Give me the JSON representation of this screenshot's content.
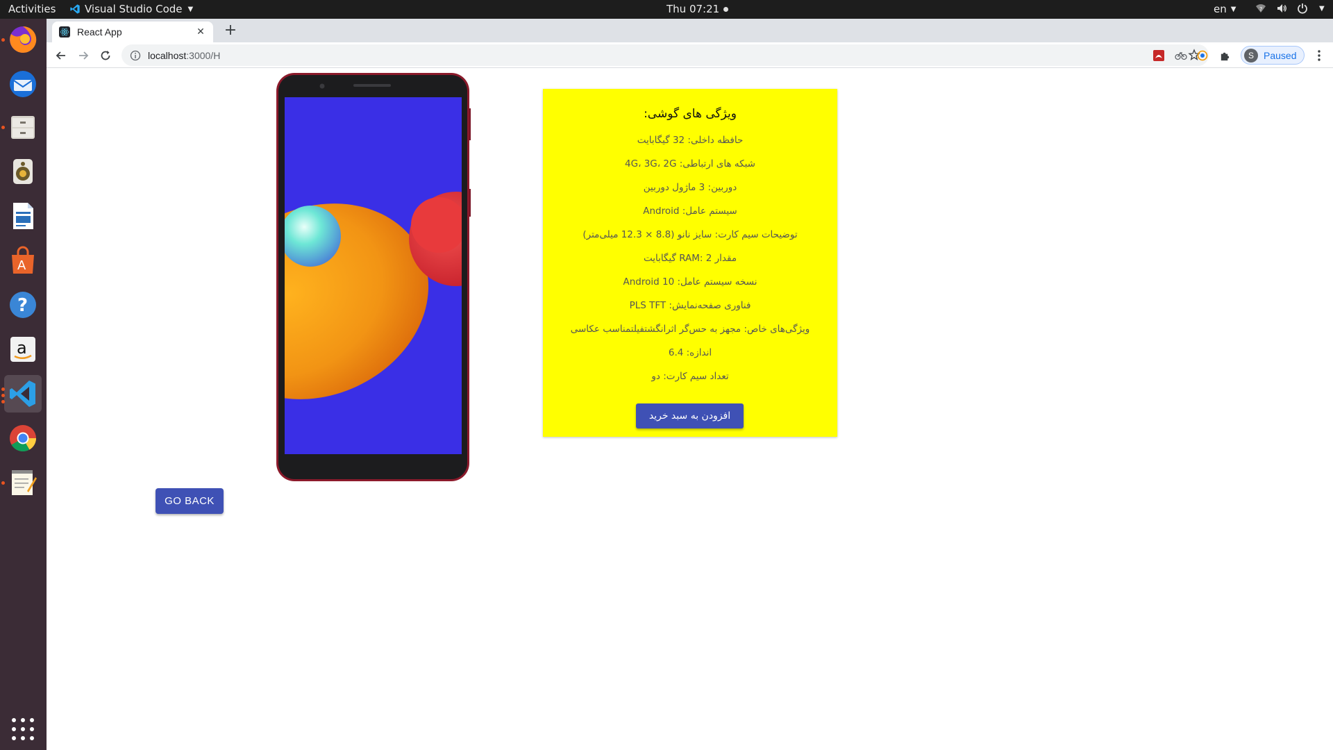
{
  "topbar": {
    "activities": "Activities",
    "app_name": "Visual Studio Code",
    "clock": "Thu 07:21",
    "language": "en"
  },
  "dock": {
    "items": [
      "Firefox",
      "Thunderbird",
      "Files",
      "Rhythmbox",
      "LibreOffice Writer",
      "Ubuntu Software",
      "Help",
      "Amazon",
      "Visual Studio Code",
      "Google Chrome",
      "Text Editor"
    ],
    "active": "Visual Studio Code"
  },
  "browser": {
    "tab_title": "React App",
    "url_host": "localhost",
    "url_rest": ":3000/H",
    "profile_initial": "S",
    "profile_status": "Paused"
  },
  "product": {
    "title": "ویژگی های گوشی:",
    "specs": [
      "حافظه داخلی: 32 گیگابایت",
      "شبکه های ارتباطی: 4G، 3G، 2G",
      "دوربین: 3 ماژول دوربین",
      "سیستم عامل: Android",
      "توضیحات سیم کارت: سایز نانو (8.8 × 12.3 میلی‌متر)",
      "مقدار RAM: 2 گیگابایت",
      "نسخه سیستم عامل: Android 10",
      "فناوری صفحه‌نمایش: PLS TFT",
      "ویژگی‌های خاص: مجهز به حس‌گر اثرانگشتفیلتمناسب عکاسی",
      "اندازه: 6.4",
      "تعداد سیم کارت: دو"
    ],
    "add_to_cart": "افزودن به سبد خرید",
    "go_back": "GO BACK"
  },
  "colors": {
    "card_bg": "#ffff00",
    "button_bg": "#3f51b5",
    "phone_frame": "#8b1a2b",
    "screen_bg": "#3a2fe6"
  }
}
